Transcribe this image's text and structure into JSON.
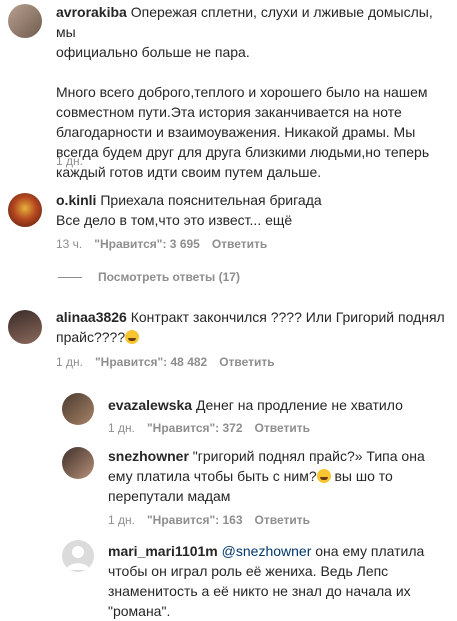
{
  "comments": [
    {
      "username": "avrorakiba",
      "text_first": "Опережая сплетни, слухи и лживые домыслы, мы",
      "text_lines": [
        "официально больше не пара.",
        "",
        "Много всего доброго,теплого и хорошего было на нашем",
        "совместном пути.Эта история заканчивается на ноте",
        "благодарности и взаимоуважения. Никакой драмы. Мы",
        "всегда будем друг для друга близкими людьми,но теперь",
        "каждый готов идти своим путем дальше."
      ],
      "time": "1 дн."
    },
    {
      "username": "o.kinli",
      "text_first": "Приехала пояснительная бригада",
      "text_lines": [
        "Все дело в том,что это извест... ещё"
      ],
      "time": "13 ч.",
      "likes": "\"Нравится\": 3 695",
      "reply": "Ответить"
    },
    {
      "username": "alinaa3826",
      "text_first": "Контракт закончился ???? Или Григорий поднял",
      "text_lines": [
        "прайс????"
      ],
      "time": "1 дн.",
      "likes": "\"Нравится\": 48 482",
      "reply": "Ответить"
    }
  ],
  "view_replies": "Посмотреть ответы (17)",
  "replies": [
    {
      "username": "evazalewska",
      "text_first": "Денег на продление не хватило",
      "text_lines": [],
      "time": "1 дн.",
      "likes": "\"Нравится\": 372",
      "reply": "Ответить"
    },
    {
      "username": "snezhowner",
      "text_first": "\"григорий поднял прайс?» Типа она",
      "text_lines": [
        "ему платила чтобы быть с ним?",
        "перепутали мадам"
      ],
      "text_after_emoji": " вы шо то",
      "time": "1 дн.",
      "likes": "\"Нравится\": 163",
      "reply": "Ответить"
    },
    {
      "username": "mari_mari1101m",
      "mention": "@snezhowner",
      "text_first": " она ему платила",
      "text_lines": [
        "чтобы он играл роль её жениха. Ведь Лепс",
        "знаменитость а её никто не знал до начала их",
        "\"романа\"."
      ]
    }
  ],
  "colors": {
    "text": "#262626",
    "meta": "#8e8e8e",
    "mention": "#00376b"
  }
}
